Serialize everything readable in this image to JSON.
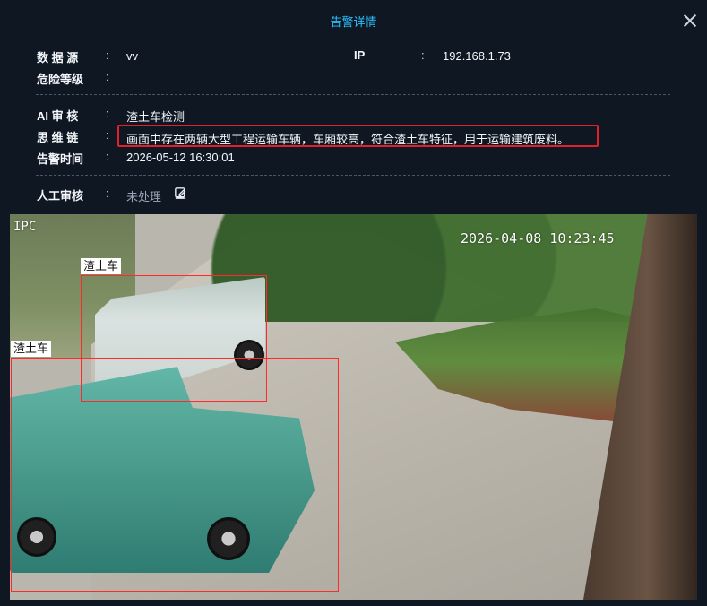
{
  "dialog": {
    "title": "告警详情"
  },
  "info": {
    "data_source_label": "数 据 源",
    "data_source_value": "vv",
    "ip_label": "IP",
    "ip_value": "192.168.1.73",
    "risk_level_label": "危险等级",
    "ai_review_label": "AI 审 核",
    "ai_review_value": "渣土车检测",
    "reasoning_label": "思 维 链",
    "reasoning_value": "画面中存在两辆大型工程运输车辆，车厢较高，符合渣土车特征，用于运输建筑废料。",
    "alarm_time_label": "告警时间",
    "alarm_time_value": "2026-05-12 16:30:01",
    "manual_review_label": "人工审核",
    "manual_review_value": "未处理"
  },
  "image": {
    "channel_label": "IPC",
    "timestamp": "2026-04-08 10:23:45",
    "detections": [
      {
        "label": "渣土车"
      },
      {
        "label": "渣土车"
      }
    ]
  },
  "colors": {
    "background": "#0f1722",
    "accent_title": "#27c2ff",
    "highlight_border": "#e0202a",
    "detection_box": "#ff2a2a"
  },
  "icons": {
    "close": "close-icon",
    "edit": "edit-icon"
  }
}
